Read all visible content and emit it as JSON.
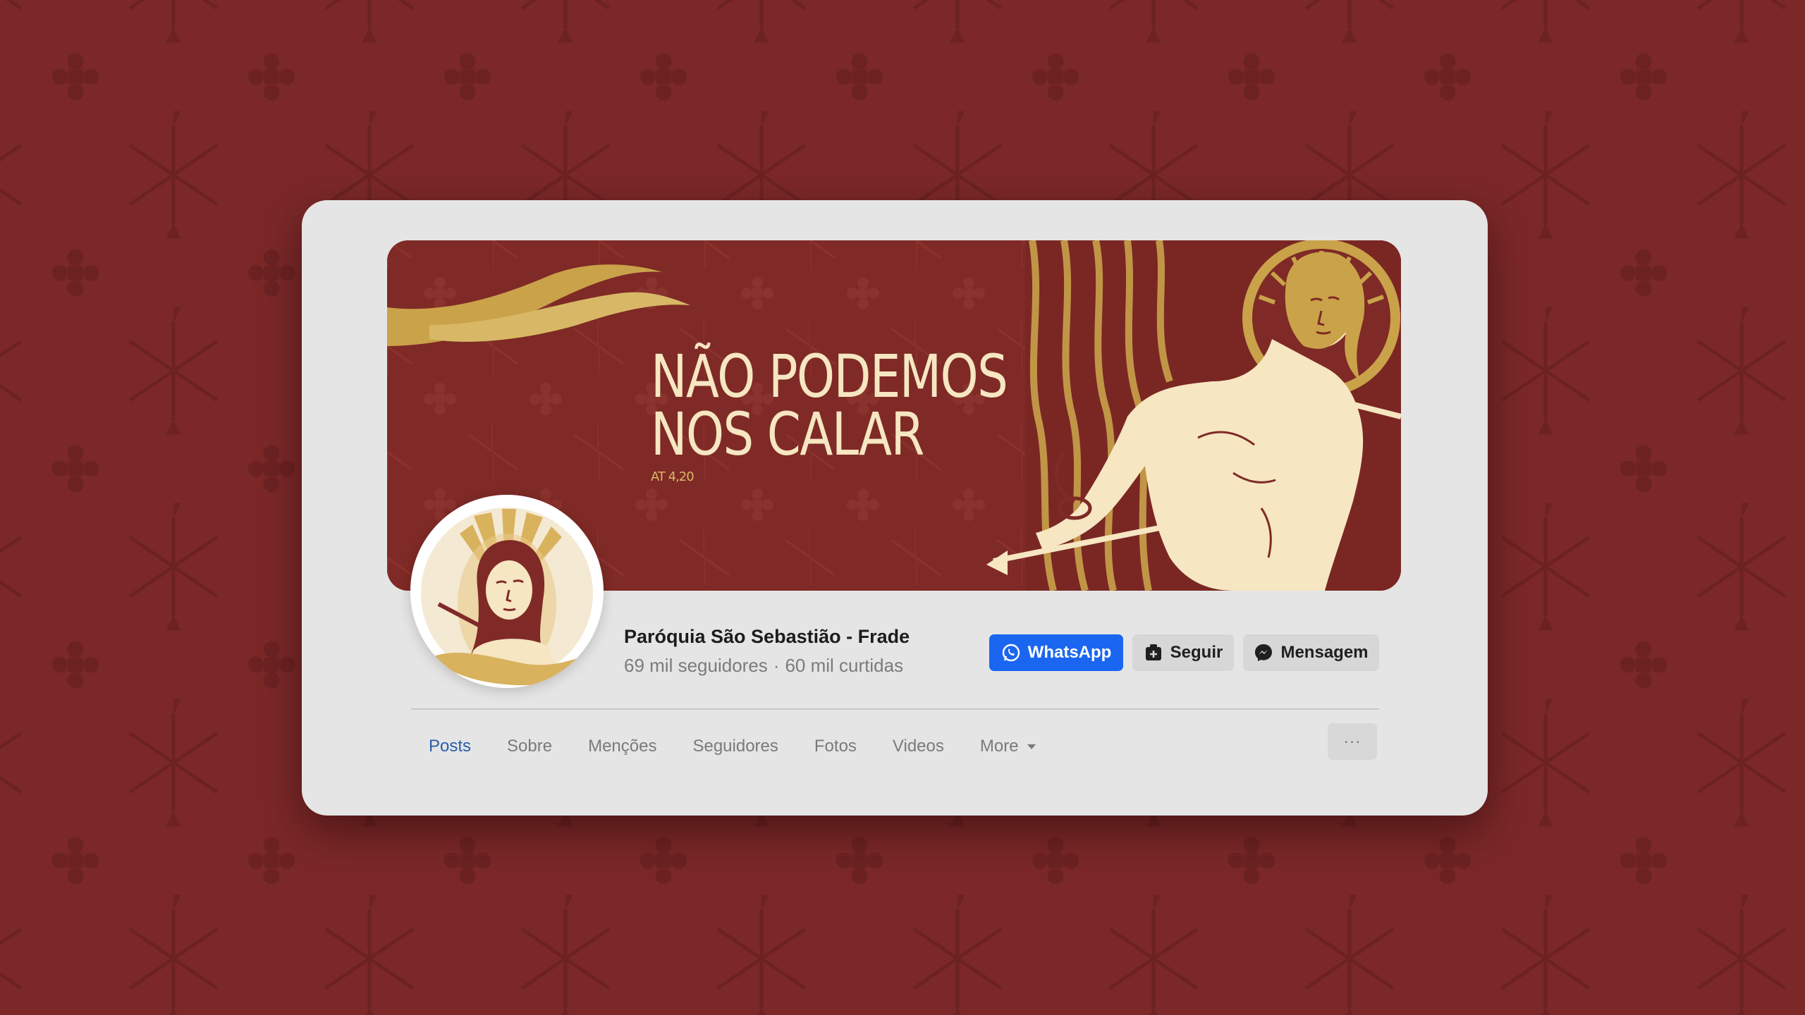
{
  "background": {
    "color": "#7c2828",
    "pattern_color": "#6a2020"
  },
  "cover": {
    "title_line1": "NÃO PODEMOS",
    "title_line2": "NOS CALAR",
    "reference": "AT 4,20",
    "background_color": "#7f2a26",
    "accent_gold": "#c9a24a",
    "figure_cream": "#f6e6c2"
  },
  "profile": {
    "name": "Paróquia São Sebastião - Frade",
    "followers": "69 mil seguidores",
    "separator": "·",
    "likes": "60 mil curtidas"
  },
  "actions": {
    "whatsapp_label": "WhatsApp",
    "follow_label": "Seguir",
    "message_label": "Mensagem",
    "whatsapp_color": "#1a66f0"
  },
  "tabs": [
    {
      "label": "Posts",
      "active": true
    },
    {
      "label": "Sobre",
      "active": false
    },
    {
      "label": "Menções",
      "active": false
    },
    {
      "label": "Seguidores",
      "active": false
    },
    {
      "label": "Fotos",
      "active": false
    },
    {
      "label": "Videos",
      "active": false
    },
    {
      "label": "More",
      "active": false
    }
  ],
  "overflow_menu_label": "···"
}
